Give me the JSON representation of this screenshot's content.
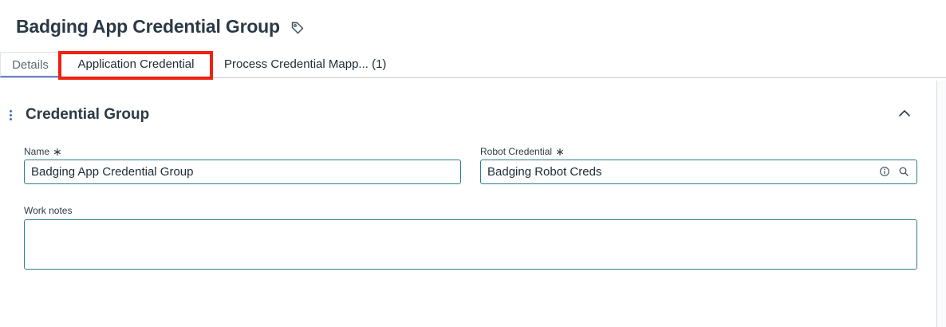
{
  "header": {
    "title": "Badging App Credential Group",
    "tag_icon": "tag-icon"
  },
  "tabs": [
    {
      "label": "Details",
      "active": true
    },
    {
      "label": "Application Credential",
      "highlighted": true
    },
    {
      "label": "Process Credential Mapp... (1)"
    }
  ],
  "section": {
    "title": "Credential Group",
    "collapse_icon": "chevron-up-icon"
  },
  "fields": {
    "name": {
      "label": "Name",
      "required_mark": "∗",
      "value": "Badging App Credential Group"
    },
    "robot_credential": {
      "label": "Robot Credential",
      "required_mark": "∗",
      "value": "Badging Robot Creds"
    },
    "work_notes": {
      "label": "Work notes",
      "value": ""
    }
  },
  "colors": {
    "input_border": "#2b7f8c",
    "highlight": "#ee2211",
    "active_tab_underline": "#6d84c9"
  }
}
